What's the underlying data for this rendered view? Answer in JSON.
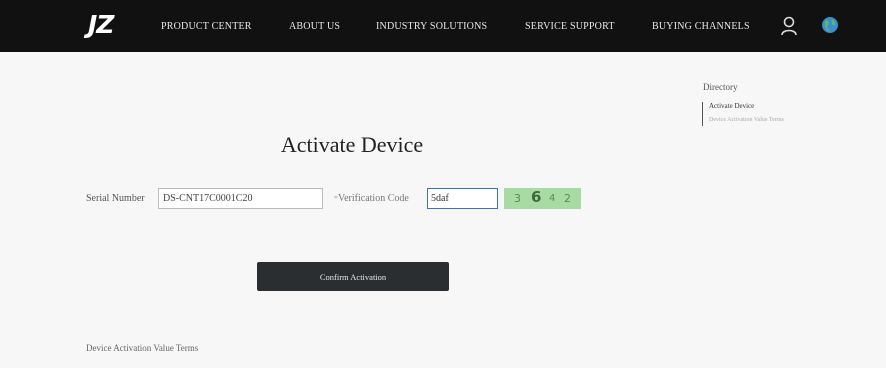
{
  "header": {
    "logo": "JZ",
    "nav": [
      "PRODUCT CENTER",
      "ABOUT US",
      "INDUSTRY SOLUTIONS",
      "SERVICE SUPPORT",
      "BUYING CHANNELS"
    ]
  },
  "directory": {
    "title": "Directory",
    "items": [
      "Activate Device",
      "Device Activation Value Terms"
    ]
  },
  "form": {
    "title": "Activate Device",
    "serial_label": "Serial Number",
    "serial_value": "DS-CNT17C0001C20",
    "verification_label": "Verification Code",
    "verification_value": "5daf",
    "captcha": [
      "3",
      "6",
      "4",
      "2"
    ],
    "confirm_label": "Confirm Activation"
  },
  "footer": {
    "notice": "Device Activation Value Terms"
  },
  "colors": {
    "navbar": "#111111",
    "captcha_bg": "#a8dba4",
    "button_bg": "#2b2e30",
    "input_focus": "#3a6fd8"
  }
}
